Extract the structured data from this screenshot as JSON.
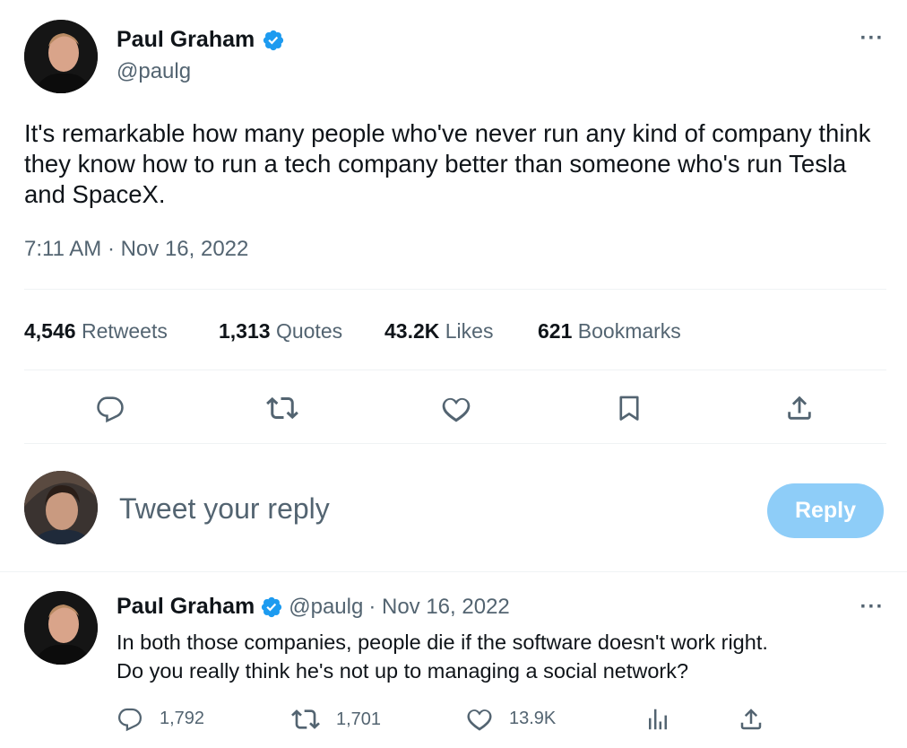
{
  "tweet": {
    "author_name": "Paul Graham",
    "author_handle": "@paulg",
    "text": "It's remarkable how many people who've never run any kind of company think they know how to run a tech company better than someone who's run Tesla and SpaceX.",
    "timestamp": "7:11 AM · Nov 16, 2022",
    "more_label": "···"
  },
  "stats": {
    "retweets": {
      "count": "4,546",
      "label": "Retweets"
    },
    "quotes": {
      "count": "1,313",
      "label": "Quotes"
    },
    "likes": {
      "count": "43.2K",
      "label": "Likes"
    },
    "bookmarks": {
      "count": "621",
      "label": "Bookmarks"
    }
  },
  "actions": [
    "reply-icon",
    "retweet-icon",
    "like-icon",
    "bookmark-icon",
    "share-icon"
  ],
  "composer": {
    "placeholder": "Tweet your reply",
    "button_label": "Reply"
  },
  "reply": {
    "author_name": "Paul Graham",
    "author_handle": "@paulg",
    "date": "· Nov 16, 2022",
    "text_line1": "In both those companies, people die if the software doesn't work right.",
    "text_line2": "Do you really think he's not up to managing a social network?",
    "more_label": "···",
    "counts": {
      "replies": "1,792",
      "retweets": "1,701",
      "likes": "13.9K"
    }
  },
  "colors": {
    "accent": "#1d9bf0",
    "reply_button": "#8ecdf8",
    "verified": "#1d9bf0",
    "secondary_text": "#536471"
  }
}
